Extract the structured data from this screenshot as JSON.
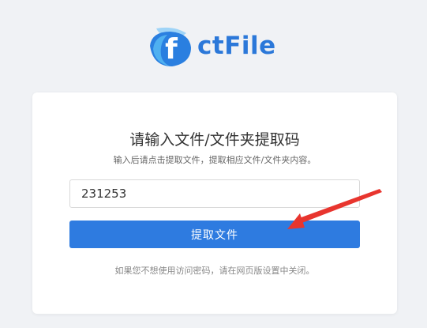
{
  "logo": {
    "brand_text": "ctFile",
    "mark_letter": "f"
  },
  "card": {
    "title": "请输入文件/文件夹提取码",
    "subtitle": "输入后请点击提取文件，提取相应文件/文件夹内容。",
    "code_input_value": "231253",
    "submit_label": "提取文件",
    "note": "如果您不想使用访问密码，请在网页版设置中关闭。"
  },
  "colors": {
    "brand_blue": "#2b78d9",
    "button_blue": "#2e7be0",
    "arrow_red": "#e8352e",
    "background": "#f0f2f5"
  },
  "icons": {
    "logo": "ctfile-logo-icon",
    "annotation": "red-arrow-icon"
  }
}
